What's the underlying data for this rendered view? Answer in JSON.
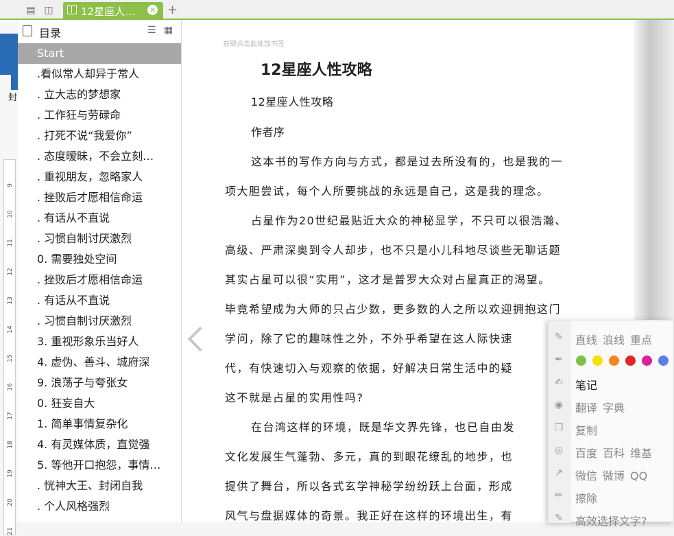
{
  "tab": {
    "title": "12星座人…"
  },
  "toc": {
    "title": "目录",
    "items": [
      "Start",
      ".看似常人却异于常人",
      ". 立大志的梦想家",
      ". 工作狂与劳碌命",
      ". 打死不说“我爱你”",
      ". 态度暧昧，不会立刻…",
      ". 重视朋友，忽略家人",
      ". 挫败后才愿相信命运",
      ". 有话从不直说",
      ". 习惯自制讨厌激烈",
      "0. 需要独处空间",
      ". 挫败后才愿相信命运",
      ". 有话从不直说",
      ". 习惯自制讨厌激烈",
      "3. 重视形象乐当好人",
      "4. 虚伪、善斗、城府深",
      "9. 浪荡子与夸张女",
      "0. 狂妄自大",
      "1. 简单事情复杂化",
      "4. 有灵媒体质，直觉强",
      "5. 等他开口抱怨，事情…",
      ". 恍神大王、封闭自我",
      ". 个人风格强烈"
    ]
  },
  "left_app": {
    "feng": "封"
  },
  "ruler": [
    "9",
    "10",
    "11",
    "12",
    "13",
    "14",
    "15",
    "16",
    "17",
    "18",
    "19",
    "20",
    "21"
  ],
  "reader": {
    "bookmark_hint": "右键点击此处加书签",
    "title": "12星座人性攻略",
    "lines": [
      "12星座人性攻略",
      "作者序",
      "这本书的写作方向与方式，都是过去所没有的，也是我的一",
      "项大胆尝试，每个人所要挑战的永远是自己，这是我的理念。",
      "占星作为20世纪最贴近大众的神秘显学，不只可以很浩瀚、",
      "高级、严肃深奥到令人却步，也不只是小儿科地尽谈些无聊话题",
      "其实占星可以很“实用”，这才是普罗大众对占星真正的渴望。",
      "毕竟希望成为大师的只占少数，更多数的人之所以欢迎拥抱这门",
      "学问，除了它的趣味性之外，不外乎希望在这人际快速",
      "代，有快速切入与观察的依据，好解决日常生活中的疑",
      "这不就是占星的实用性吗?",
      "在台湾这样的环境，既是华文界先锋，也已自由发",
      "文化发展生气蓬勃、多元，真的到眼花缭乱的地步，也",
      "提供了舞台，所以各式玄学神秘学纷纷跃上台面，形成",
      "风气与盘据媒体的奇景。我正好在这样的环境出生，有"
    ]
  },
  "menu": {
    "line_styles": [
      "直线",
      "浪线",
      "重点"
    ],
    "colors": [
      "#7dc242",
      "#f5e000",
      "#f7851f",
      "#e0262b",
      "#d9229a",
      "#5b7fe4"
    ],
    "note": "笔记",
    "translate": [
      "翻译",
      "字典"
    ],
    "copy": "复制",
    "search": [
      "百度",
      "百科",
      "维基"
    ],
    "share": [
      "微信",
      "微博",
      "QQ"
    ],
    "erase": "擦除",
    "tip": "高效选择文字?"
  }
}
